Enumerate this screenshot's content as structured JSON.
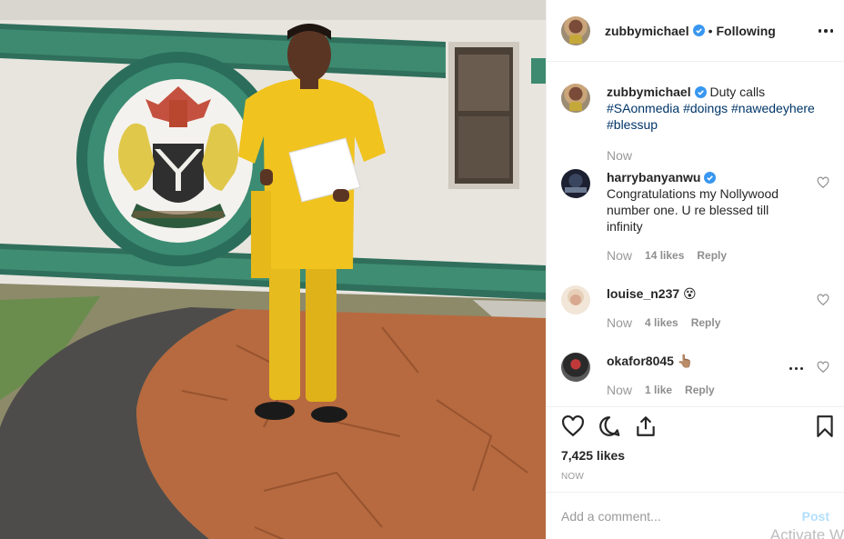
{
  "post": {
    "author": "zubbymichael",
    "follow_status": "Following",
    "separator": "•"
  },
  "caption": {
    "username": "zubbymichael",
    "text": "Duty calls",
    "hashtags": [
      "#SAonmedia",
      "#doings",
      "#nawedeyhere",
      "#blessup"
    ],
    "time": "Now"
  },
  "comments": [
    {
      "username": "harrybanyanwu",
      "verified": true,
      "text": "Congratulations my Nollywood number one. U re blessed till infinity",
      "time": "Now",
      "likes": "14 likes",
      "reply": "Reply"
    },
    {
      "username": "louise_n237",
      "verified": false,
      "text": "😵",
      "time": "Now",
      "likes": "4 likes",
      "reply": "Reply"
    },
    {
      "username": "okafor8045",
      "verified": false,
      "text": "👆🏽",
      "time": "Now",
      "likes": "1 like",
      "reply": "Reply"
    }
  ],
  "engagement": {
    "likes": "7,425 likes",
    "posted": "NOW"
  },
  "add_comment": {
    "placeholder": "Add a comment...",
    "post_label": "Post"
  },
  "overlay": {
    "watermark": "Activate W"
  },
  "icons": {
    "verified": "verified-badge-icon",
    "more": "more-options-icon",
    "like": "heart-icon",
    "comment": "comment-bubble-icon",
    "share": "share-icon",
    "save": "bookmark-icon"
  },
  "colors": {
    "verified_blue": "#3897f0",
    "hashtag": "#003569",
    "muted": "#8e8e8e",
    "post_disabled": "#b2dffc"
  }
}
